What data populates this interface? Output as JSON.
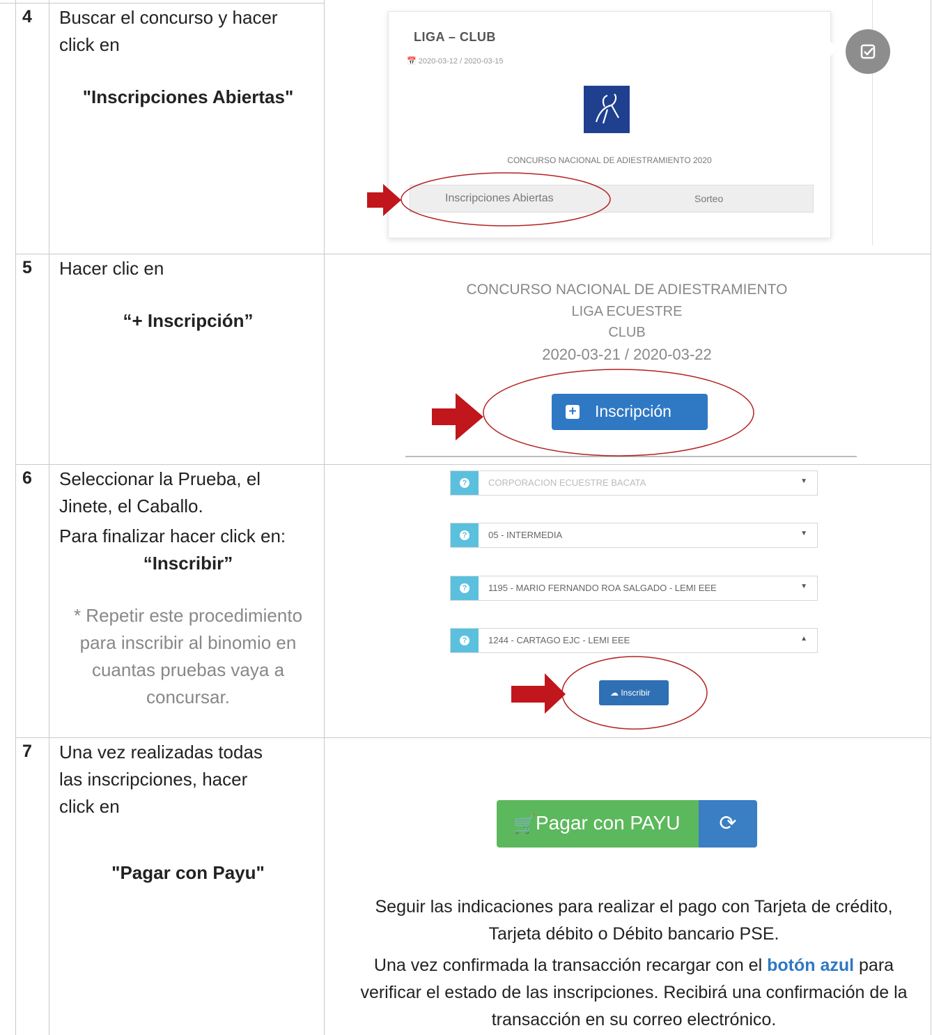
{
  "steps": [
    {
      "number": "4",
      "text": "Buscar el concurso y hacer click en",
      "bold": "\"Inscripciones Abiertas\""
    },
    {
      "number": "5",
      "text": "Hacer clic en",
      "bold": "“+ Inscripción”"
    },
    {
      "number": "6",
      "text_line1": "Seleccionar la Prueba, el Jinete, el Caballo.",
      "text_line2": "Para finalizar hacer click en:",
      "bold": "“Inscribir”",
      "note": "* Repetir este procedimiento para inscribir al binomio en cuantas pruebas vaya a concursar."
    },
    {
      "number": "7",
      "text": "Una vez realizadas todas las inscripciones, hacer click en",
      "bold": "\"Pagar con Payu\""
    }
  ],
  "step4_screenshot": {
    "title": "LIGA – CLUB",
    "dates": "2020-03-12 / 2020-03-15",
    "event_name": "CONCURSO NACIONAL DE ADIESTRAMIENTO 2020",
    "button_inscripciones": "Inscripciones Abiertas",
    "button_sorteo": "Sorteo"
  },
  "step5_screenshot": {
    "line1": "CONCURSO NACIONAL DE ADIESTRAMIENTO",
    "line2": "LIGA ECUESTRE",
    "line3": "CLUB",
    "line4": "2020-03-21 / 2020-03-22",
    "button_label": "Inscripción"
  },
  "step6_screenshot": {
    "selects": [
      "CORPORACION ECUESTRE BACATA",
      "05 - INTERMEDIA",
      "1195 - MARIO FERNANDO ROA SALGADO - LEMI EEE",
      "1244 - CARTAGO EJC - LEMI EEE"
    ],
    "button_label": "Inscribir"
  },
  "step7_screenshot": {
    "pay_button": "Pagar con PAYU",
    "instructions": "Seguir las indicaciones para realizar el pago con Tarjeta de crédito, Tarjeta débito o Débito bancario PSE.",
    "confirm_before": "Una vez confirmada la transacción recargar con el",
    "confirm_highlight": "botón azul",
    "confirm_after": "para verificar el estado de las inscripciones. Recibirá una confirmación de la transacción en su correo electrónico."
  },
  "colors": {
    "pay_green": "#5cb85c",
    "refresh_blue": "#3a7ec3",
    "button_blue": "#2f78c4",
    "info_cyan": "#5bc0de",
    "arrow_red": "#c0161c",
    "ellipse_red": "#b22222"
  },
  "icons": [
    "calendar-icon",
    "check-icon",
    "plus-icon",
    "info-icon",
    "cloud-upload-icon",
    "cart-icon",
    "refresh-icon",
    "red-arrow-icon"
  ]
}
